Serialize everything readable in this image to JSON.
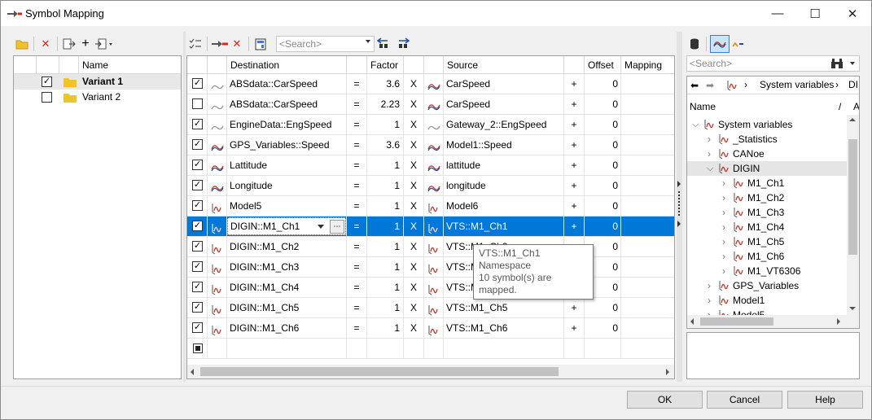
{
  "window": {
    "title": "Symbol Mapping",
    "minimize": "—",
    "maximize": "☐",
    "close": "✕"
  },
  "variants": {
    "header": "Name",
    "items": [
      {
        "name": "Variant 1",
        "checked": true,
        "bold": true
      },
      {
        "name": "Variant 2",
        "checked": false,
        "bold": false
      }
    ]
  },
  "mapping": {
    "search_placeholder": "<Search>",
    "headers": {
      "destination": "Destination",
      "factor": "Factor",
      "source": "Source",
      "offset": "Offset",
      "mapping": "Mapping"
    },
    "rows": [
      {
        "checked": true,
        "dest": "ABSdata::CarSpeed",
        "eq": "=",
        "factor": "3.6",
        "x": "X",
        "source": "CarSpeed",
        "plus": "+",
        "offset": "0",
        "dest_icon": "tilde-gray",
        "src_icon": "tilde-color"
      },
      {
        "checked": false,
        "dest": "ABSdata::CarSpeed",
        "eq": "=",
        "factor": "2.23",
        "x": "X",
        "source": "CarSpeed",
        "plus": "+",
        "offset": "0",
        "dest_icon": "tilde-gray",
        "src_icon": "tilde-color"
      },
      {
        "checked": true,
        "dest": "EngineData::EngSpeed",
        "eq": "=",
        "factor": "1",
        "x": "X",
        "source": "Gateway_2::EngSpeed",
        "plus": "+",
        "offset": "0",
        "dest_icon": "tilde-gray",
        "src_icon": "tilde-gray"
      },
      {
        "checked": true,
        "dest": "GPS_Variables::Speed",
        "eq": "=",
        "factor": "3.6",
        "x": "X",
        "source": "Model1::Speed",
        "plus": "+",
        "offset": "0",
        "dest_icon": "tilde-color",
        "src_icon": "tilde-color"
      },
      {
        "checked": true,
        "dest": "Lattitude",
        "eq": "=",
        "factor": "1",
        "x": "X",
        "source": "lattitude",
        "plus": "+",
        "offset": "0",
        "dest_icon": "tilde-color",
        "src_icon": "tilde-color"
      },
      {
        "checked": true,
        "dest": "Longitude",
        "eq": "=",
        "factor": "1",
        "x": "X",
        "source": "longitude",
        "plus": "+",
        "offset": "0",
        "dest_icon": "tilde-color",
        "src_icon": "tilde-color"
      },
      {
        "checked": true,
        "dest": "Model5",
        "eq": "=",
        "factor": "1",
        "x": "X",
        "source": "Model6",
        "plus": "+",
        "offset": "0",
        "dest_icon": "ns",
        "src_icon": "ns"
      },
      {
        "checked": true,
        "dest": "DIGIN::M1_Ch1",
        "eq": "=",
        "factor": "1",
        "x": "X",
        "source": "VTS::M1_Ch1",
        "plus": "+",
        "offset": "0",
        "dest_icon": "ns",
        "src_icon": "ns",
        "selected": true
      },
      {
        "checked": true,
        "dest": "DIGIN::M1_Ch2",
        "eq": "=",
        "factor": "1",
        "x": "X",
        "source": "VTS::M1_Ch2",
        "plus": "+",
        "offset": "0",
        "dest_icon": "ns",
        "src_icon": "ns"
      },
      {
        "checked": true,
        "dest": "DIGIN::M1_Ch3",
        "eq": "=",
        "factor": "1",
        "x": "X",
        "source": "VTS::M1_Ch3",
        "plus": "+",
        "offset": "0",
        "dest_icon": "ns",
        "src_icon": "ns"
      },
      {
        "checked": true,
        "dest": "DIGIN::M1_Ch4",
        "eq": "=",
        "factor": "1",
        "x": "X",
        "source": "VTS::M1_Ch4",
        "plus": "+",
        "offset": "0",
        "dest_icon": "ns",
        "src_icon": "ns"
      },
      {
        "checked": true,
        "dest": "DIGIN::M1_Ch5",
        "eq": "=",
        "factor": "1",
        "x": "X",
        "source": "VTS::M1_Ch5",
        "plus": "+",
        "offset": "0",
        "dest_icon": "ns",
        "src_icon": "ns"
      },
      {
        "checked": true,
        "dest": "DIGIN::M1_Ch6",
        "eq": "=",
        "factor": "1",
        "x": "X",
        "source": "VTS::M1_Ch6",
        "plus": "+",
        "offset": "0",
        "dest_icon": "ns",
        "src_icon": "ns"
      }
    ],
    "tooltip": {
      "line1": "VTS::M1_Ch1",
      "line2": "Namespace",
      "line3": "10 symbol(s) are mapped."
    }
  },
  "symbols": {
    "search_placeholder": "<Search>",
    "breadcrumb": "System variables",
    "breadcrumb_tail": "DI",
    "header_name": "Name",
    "header_slash": "/",
    "header_a": "A",
    "tree": [
      {
        "label": "System variables",
        "level": 0,
        "expand": "open"
      },
      {
        "label": "_Statistics",
        "level": 1,
        "expand": "closed"
      },
      {
        "label": "CANoe",
        "level": 1,
        "expand": "closed"
      },
      {
        "label": "DIGIN",
        "level": 1,
        "expand": "open",
        "highlight": true
      },
      {
        "label": "M1_Ch1",
        "level": 2,
        "expand": "closed"
      },
      {
        "label": "M1_Ch2",
        "level": 2,
        "expand": "closed"
      },
      {
        "label": "M1_Ch3",
        "level": 2,
        "expand": "closed"
      },
      {
        "label": "M1_Ch4",
        "level": 2,
        "expand": "closed"
      },
      {
        "label": "M1_Ch5",
        "level": 2,
        "expand": "closed"
      },
      {
        "label": "M1_Ch6",
        "level": 2,
        "expand": "closed"
      },
      {
        "label": "M1_VT6306",
        "level": 2,
        "expand": "closed"
      },
      {
        "label": "GPS_Variables",
        "level": 1,
        "expand": "closed"
      },
      {
        "label": "Model1",
        "level": 1,
        "expand": "closed"
      },
      {
        "label": "Model5",
        "level": 1,
        "expand": "closed"
      }
    ]
  },
  "buttons": {
    "ok": "OK",
    "cancel": "Cancel",
    "help": "Help"
  },
  "colors": {
    "selection": "#0078d7",
    "folder": "#f2c12e",
    "delete": "#d9271c",
    "signal_red": "#c0392b",
    "signal_blue": "#1f4e9c"
  }
}
